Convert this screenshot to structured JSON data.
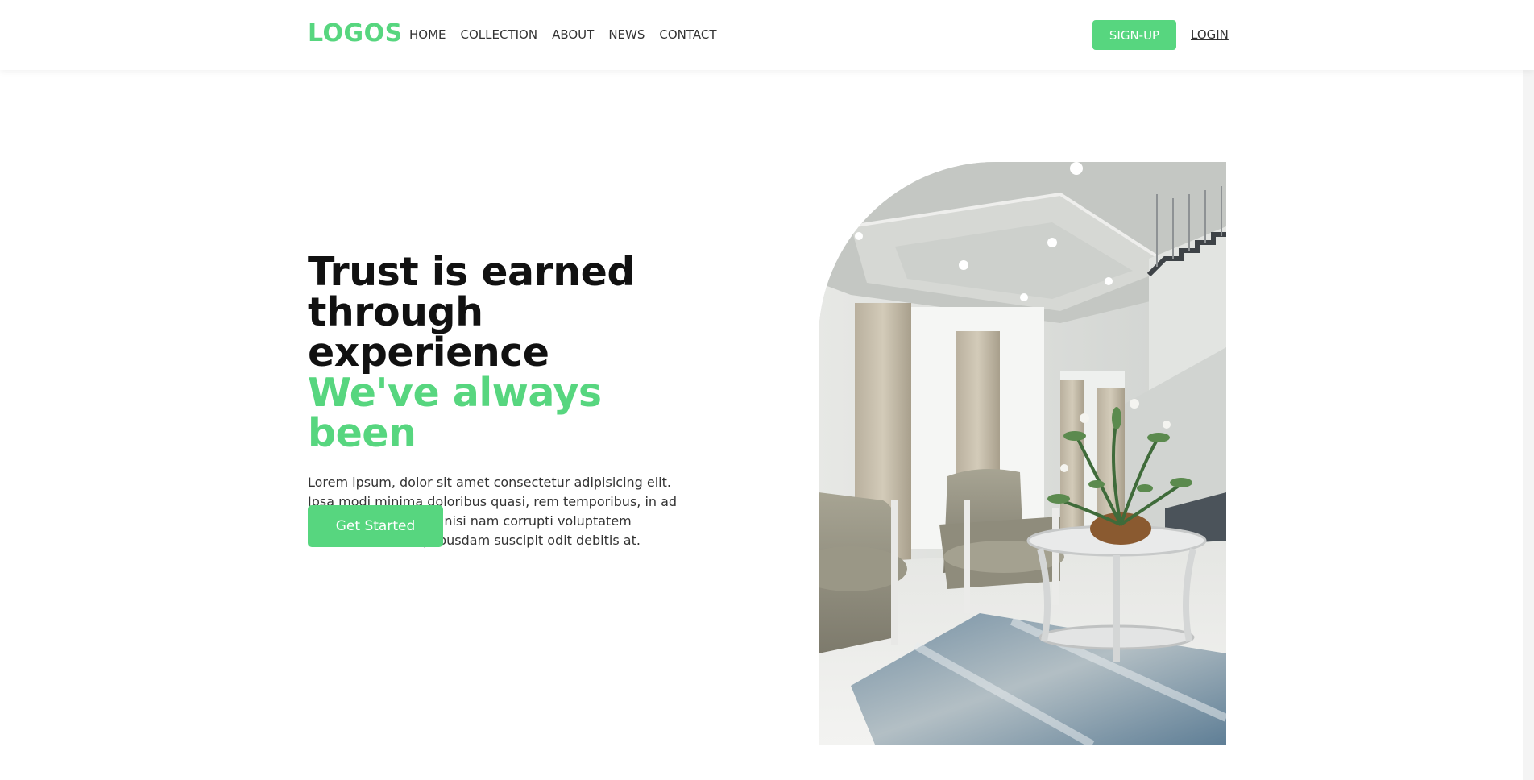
{
  "header": {
    "logo": "LOGOS",
    "nav": [
      "HOME",
      "COLLECTION",
      "ABOUT",
      "NEWS",
      "CONTACT"
    ],
    "signup_label": "SIGN-UP",
    "login_label": "LOGIN"
  },
  "hero": {
    "title_line1": "Trust is earned",
    "title_line2": "through experience",
    "title_accent": "We've always been",
    "description": "Lorem ipsum, dolor sit amet consectetur adipisicing elit. Ipsa modi minima doloribus quasi, rem temporibus, in ad quisquam architecto nisi nam corrupti voluptatem mollitia delectus quibusdam suscipit odit debitis at.",
    "cta_label": "Get Started"
  },
  "colors": {
    "accent": "#57d67f",
    "text": "#111111"
  }
}
